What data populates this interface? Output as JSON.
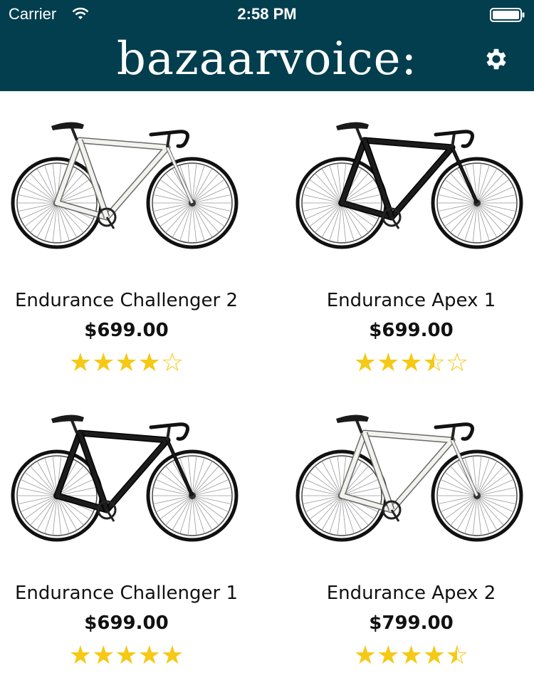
{
  "status": {
    "carrier": "Carrier",
    "time": "2:58 PM"
  },
  "header": {
    "brand": "bazaarvoice:",
    "bg_color": "#023e4e"
  },
  "colors": {
    "star": "#f5c915"
  },
  "products": [
    {
      "name": "Endurance Challenger 2",
      "price": "$699.00",
      "rating": 4,
      "frame": "white"
    },
    {
      "name": "Endurance Apex 1",
      "price": "$699.00",
      "rating": 3.5,
      "frame": "black"
    },
    {
      "name": "Endurance Challenger 1",
      "price": "$699.00",
      "rating": 5,
      "frame": "black"
    },
    {
      "name": "Endurance Apex 2",
      "price": "$799.00",
      "rating": 4.5,
      "frame": "white"
    }
  ]
}
